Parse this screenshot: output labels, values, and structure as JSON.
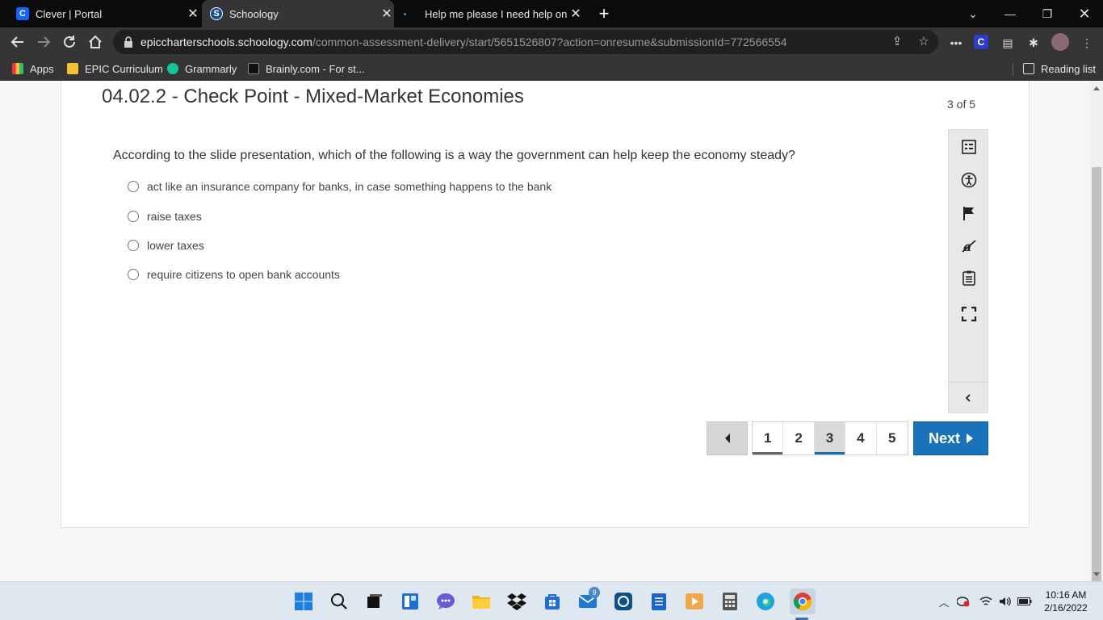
{
  "browser": {
    "tabs": [
      {
        "title": "Clever | Portal",
        "favicon": "clever-icon",
        "active": false
      },
      {
        "title": "Schoology",
        "favicon": "schoology-icon",
        "active": true
      },
      {
        "title": "Help me please I need help on Sc",
        "favicon": "brainly-icon",
        "active": false
      }
    ],
    "url_host": "epiccharterschools.schoology.com",
    "url_path": "/common-assessment-delivery/start/5651526807?action=onresume&submissionId=772566554",
    "bookmarks": [
      {
        "label": "Apps",
        "icon": "apps-grid-icon"
      },
      {
        "label": "EPIC Curriculum",
        "icon": "folder-icon"
      },
      {
        "label": "Grammarly",
        "icon": "grammarly-icon"
      },
      {
        "label": "Brainly.com - For st...",
        "icon": "brainly-icon"
      }
    ],
    "reading_list": "Reading list"
  },
  "quiz": {
    "title": "04.02.2 - Check Point - Mixed-Market Economies",
    "counter": "3 of 5",
    "question": "According to the slide presentation, which of the following is a way the government can help keep the economy steady?",
    "options": [
      "act like an insurance company for banks, in case something happens to the bank",
      "raise taxes",
      "lower taxes",
      "require citizens to open bank accounts"
    ],
    "pages": [
      "1",
      "2",
      "3",
      "4",
      "5"
    ],
    "current_page": "3",
    "next_label": "Next",
    "tools": [
      "question-list-icon",
      "accessibility-icon",
      "flag-icon",
      "answer-eliminator-icon",
      "notepad-icon",
      "fullscreen-icon"
    ]
  },
  "taskbar": {
    "mail_badge": "9",
    "time": "10:16 AM",
    "date": "2/16/2022"
  },
  "colors": {
    "accent": "#1a73b8",
    "chrome_dark": "#353535",
    "tabstrip": "#0b0b0b"
  }
}
